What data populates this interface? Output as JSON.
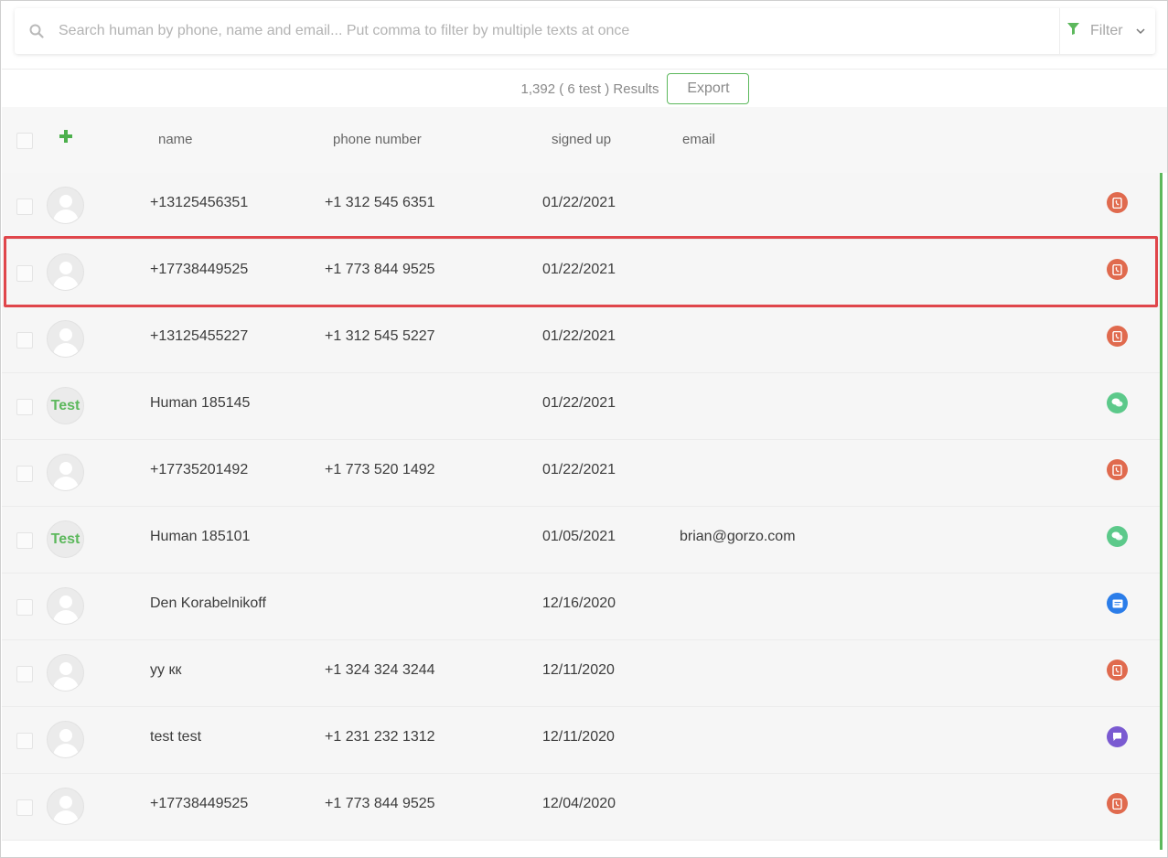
{
  "search": {
    "placeholder": "Search human by phone, name and email... Put comma to filter by multiple texts at once",
    "value": ""
  },
  "filter": {
    "label": "Filter"
  },
  "results": {
    "text": "1,392 ( 6 test ) Results",
    "export_label": "Export"
  },
  "colors": {
    "accent_green": "#5cb85c",
    "highlight_red": "#e0464b",
    "phone_orange": "#e06a4e",
    "chat_green": "#5cc98a",
    "email_blue": "#2b7de9",
    "message_purple": "#7a5ad1"
  },
  "table": {
    "headers": {
      "name": "name",
      "phone": "phone number",
      "signed": "signed up",
      "email": "email"
    },
    "rows": [
      {
        "name": "+13125456351",
        "phone": "+1 312 545 6351",
        "signed": "01/22/2021",
        "email": "",
        "avatar": "user-icon",
        "channel": "phone-icon"
      },
      {
        "name": "+17738449525",
        "phone": "+1 773 844 9525",
        "signed": "01/22/2021",
        "email": "",
        "avatar": "user-icon",
        "channel": "phone-icon"
      },
      {
        "name": "+13125455227",
        "phone": "+1 312 545 5227",
        "signed": "01/22/2021",
        "email": "",
        "avatar": "user-icon",
        "channel": "phone-icon"
      },
      {
        "name": "Human 185145",
        "phone": "",
        "signed": "01/22/2021",
        "email": "",
        "avatar": "Test",
        "channel": "chat-icon"
      },
      {
        "name": "+17735201492",
        "phone": "+1 773 520 1492",
        "signed": "01/22/2021",
        "email": "",
        "avatar": "user-icon",
        "channel": "phone-icon"
      },
      {
        "name": "Human 185101",
        "phone": "",
        "signed": "01/05/2021",
        "email": "brian@gorzo.com",
        "avatar": "Test",
        "channel": "chat-icon"
      },
      {
        "name": "Den Korabelnikoff",
        "phone": "",
        "signed": "12/16/2020",
        "email": "",
        "avatar": "user-icon",
        "channel": "email-icon"
      },
      {
        "name": "уу кк",
        "phone": "+1 324 324 3244",
        "signed": "12/11/2020",
        "email": "",
        "avatar": "user-icon",
        "channel": "phone-icon"
      },
      {
        "name": "test test",
        "phone": "+1 231 232 1312",
        "signed": "12/11/2020",
        "email": "",
        "avatar": "user-icon",
        "channel": "message-icon"
      },
      {
        "name": "+17738449525",
        "phone": "+1 773 844 9525",
        "signed": "12/04/2020",
        "email": "",
        "avatar": "user-icon",
        "channel": "phone-icon"
      }
    ]
  }
}
